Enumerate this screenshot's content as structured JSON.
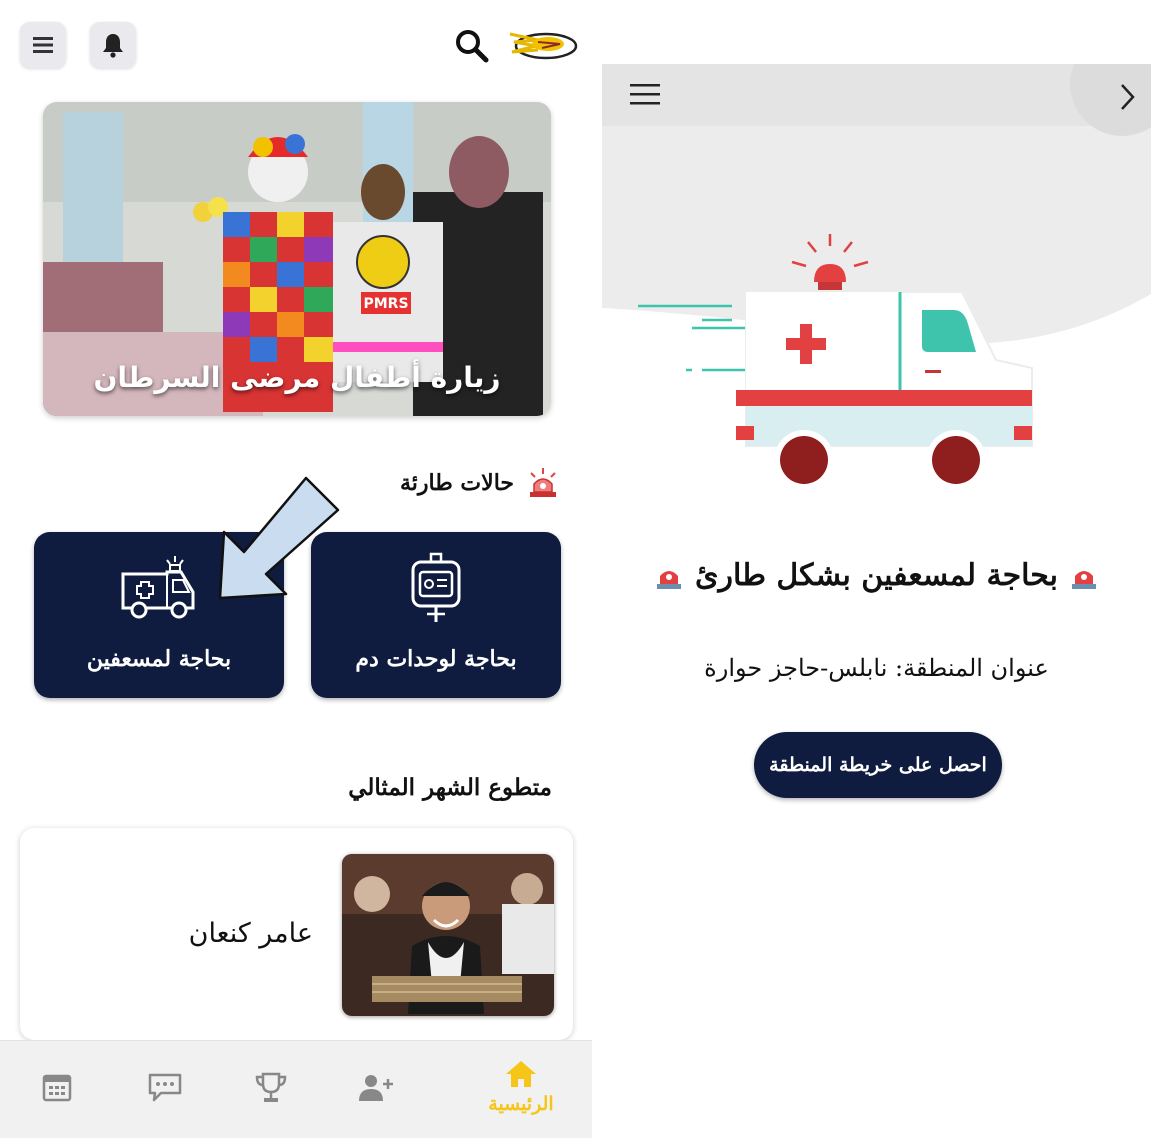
{
  "home": {
    "banner_caption": "زيارة أطفال مرضى السرطان",
    "banner_vest_text": "PMRS",
    "emergency_section_title": "حالات طارئة",
    "cards": {
      "blood_units": "بحاجة لوحدات دم",
      "paramedics": "بحاجة لمسعفين"
    },
    "volunteer_section_title": "متطوع الشهر المثالي",
    "volunteer_name": "عامر كنعان",
    "nav": {
      "home_label": "الرئيسية"
    },
    "colors": {
      "card_bg": "#0f1c3f",
      "accent": "#f5c518",
      "arrow_fill": "#c9dcf0"
    },
    "icons": [
      "menu-icon",
      "bell-icon",
      "search-icon",
      "logo",
      "siren-icon",
      "blood-bag-icon",
      "ambulance-icon",
      "calendar-icon",
      "chat-icon",
      "trophy-icon",
      "add-user-icon",
      "home-icon"
    ]
  },
  "detail": {
    "title": "بحاجة لمسعفين بشكل طارئ",
    "area_text": "عنوان المنطقة: نابلس-حاجز حوارة",
    "map_button": "احصل على خريطة المنطقة",
    "icons": [
      "menu-icon",
      "chevron-right-icon",
      "ambulance-illustration",
      "siren-icon"
    ]
  }
}
